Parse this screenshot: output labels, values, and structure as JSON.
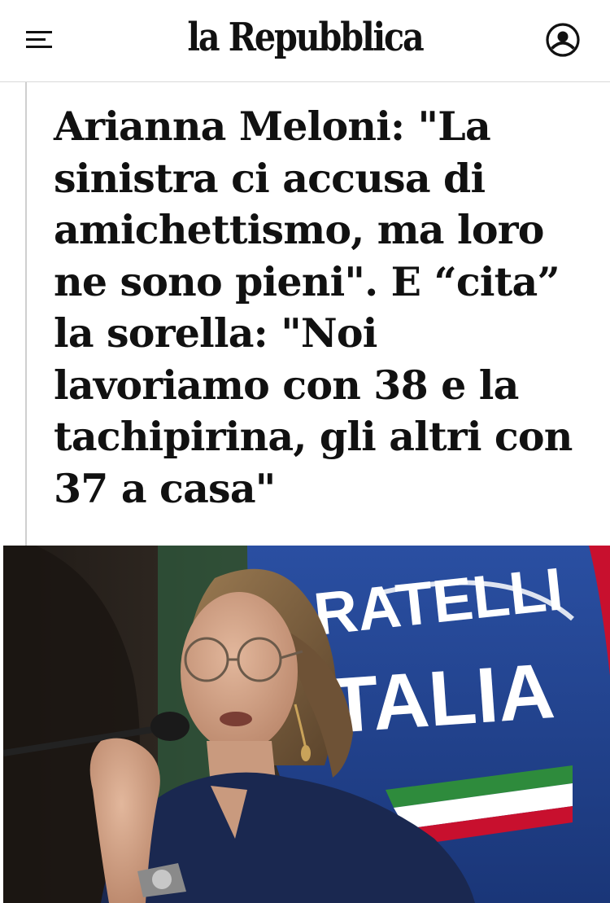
{
  "header": {
    "logo": "la Repubblica",
    "menu_icon": "hamburger-menu-icon",
    "account_icon": "user-account-icon"
  },
  "article": {
    "headline": "Arianna Meloni: \"La sinistra ci accusa di amichettismo, ma loro ne sono pieni\". E “cita” la sorella: \"Noi lavoriamo con 38 e la tachipirina, gli altri con 37 a casa\""
  },
  "photo": {
    "banner_line1": "RATELLI",
    "banner_line2": "TALIA"
  },
  "colors": {
    "text": "#111111",
    "banner_blue": "#1d3f8c",
    "flag_green": "#2e8b3c",
    "flag_red": "#c8102e",
    "jacket": "#1a2850"
  }
}
